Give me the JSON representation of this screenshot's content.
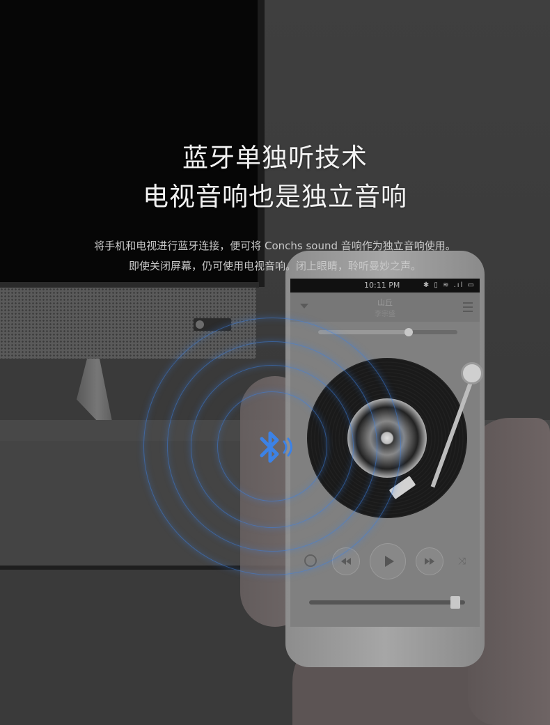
{
  "headline": {
    "line1": "蓝牙单独听技术",
    "line2": "电视音响也是独立音响"
  },
  "description": {
    "line1": "将手机和电视进行蓝牙连接，便可将 Conchs sound 音响作为独立音响使用。",
    "line2": "即使关闭屏幕，仍可使用电视音响。闭上眼睛，聆听曼妙之声。"
  },
  "phone": {
    "status_time": "10:11 PM",
    "song_title": "山丘",
    "song_artist": "李宗盛",
    "playback_progress": 0.65,
    "volume_level": 0.97
  },
  "colors": {
    "bluetooth_accent": "#3c82e6",
    "headline_text": "#f2f2f2",
    "description_text": "#c9c9c9"
  },
  "icons": [
    "bluetooth-icon",
    "menu-down-icon",
    "list-icon",
    "repeat-icon",
    "previous-icon",
    "play-icon",
    "next-icon",
    "shuffle-icon"
  ]
}
